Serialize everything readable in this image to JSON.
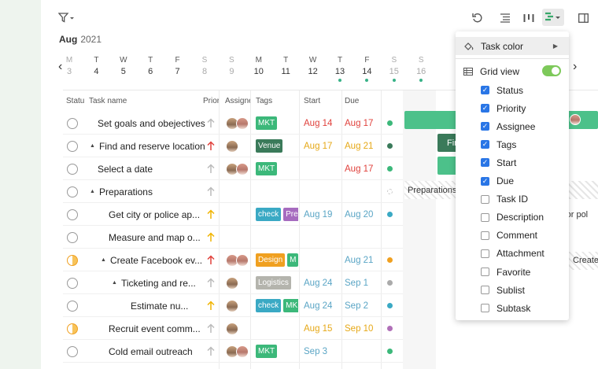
{
  "header": {
    "month": "Aug",
    "year": "2021"
  },
  "days": [
    {
      "w": "M",
      "d": "3",
      "weekend": true,
      "dot": false
    },
    {
      "w": "T",
      "d": "4",
      "weekend": false,
      "dot": false
    },
    {
      "w": "W",
      "d": "5",
      "weekend": false,
      "dot": false
    },
    {
      "w": "T",
      "d": "6",
      "weekend": false,
      "dot": false
    },
    {
      "w": "F",
      "d": "7",
      "weekend": false,
      "dot": false
    },
    {
      "w": "S",
      "d": "8",
      "weekend": true,
      "dot": false
    },
    {
      "w": "S",
      "d": "9",
      "weekend": true,
      "dot": false
    },
    {
      "w": "M",
      "d": "10",
      "weekend": false,
      "dot": false
    },
    {
      "w": "T",
      "d": "11",
      "weekend": false,
      "dot": false
    },
    {
      "w": "W",
      "d": "12",
      "weekend": false,
      "dot": false
    },
    {
      "w": "T",
      "d": "13",
      "weekend": false,
      "dot": true
    },
    {
      "w": "F",
      "d": "14",
      "weekend": false,
      "dot": true
    },
    {
      "w": "S",
      "d": "15",
      "weekend": true,
      "dot": true
    },
    {
      "w": "S",
      "d": "16",
      "weekend": true,
      "dot": true
    }
  ],
  "columns": {
    "status": "Statu",
    "name": "Task name",
    "priority": "Prior",
    "assignee": "Assigne",
    "tags": "Tags",
    "start": "Start",
    "due": "Due"
  },
  "rows": [
    {
      "status": "open",
      "indent": 0,
      "tri": false,
      "name": "Set goals and obejectives",
      "prio": "low",
      "avatars": [
        "m",
        "f"
      ],
      "tags": [
        {
          "t": "MKT",
          "c": "#3cb87a"
        }
      ],
      "start": "Aug 14",
      "startColor": "#e0413c",
      "due": "Aug 17",
      "dueColor": "#e0413c",
      "dot": "#3cb87a"
    },
    {
      "status": "open",
      "indent": 0,
      "tri": true,
      "name": "Find and reserve location",
      "prio": "high",
      "avatars": [
        "m"
      ],
      "tags": [
        {
          "t": "Venue",
          "c": "#3a7a5a"
        }
      ],
      "start": "Aug 17",
      "startColor": "#e6a817",
      "due": "Aug 21",
      "dueColor": "#e6a817",
      "dot": "#3a7a5a"
    },
    {
      "status": "open",
      "indent": 0,
      "tri": false,
      "name": "Select a date",
      "prio": "low",
      "avatars": [
        "m",
        "f"
      ],
      "tags": [
        {
          "t": "MKT",
          "c": "#3cb87a"
        }
      ],
      "start": "",
      "startColor": "#333",
      "due": "Aug 17",
      "dueColor": "#e0413c",
      "dot": "#3cb87a"
    },
    {
      "status": "open",
      "indent": 0,
      "tri": true,
      "name": "Preparations",
      "prio": "low",
      "avatars": [],
      "tags": [],
      "start": "",
      "startColor": "#333",
      "due": "",
      "dueColor": "#333",
      "dot": "hatch"
    },
    {
      "status": "open",
      "indent": 1,
      "tri": false,
      "name": "Get city or police ap...",
      "prio": "med",
      "avatars": [],
      "tags": [
        {
          "t": "check",
          "c": "#3aa9c4"
        },
        {
          "t": "Pre",
          "c": "#a66bbf"
        }
      ],
      "start": "Aug 19",
      "startColor": "#5aa5c5",
      "due": "Aug 20",
      "dueColor": "#5aa5c5",
      "dot": "#3aa9c4"
    },
    {
      "status": "open",
      "indent": 1,
      "tri": false,
      "name": "Measure and map o...",
      "prio": "med",
      "avatars": [],
      "tags": [],
      "start": "",
      "startColor": "#333",
      "due": "",
      "dueColor": "#333",
      "dot": ""
    },
    {
      "status": "half",
      "indent": 1,
      "tri": true,
      "name": "Create Facebook ev...",
      "prio": "high",
      "avatars": [
        "f",
        "f"
      ],
      "tags": [
        {
          "t": "Design",
          "c": "#f0a020"
        },
        {
          "t": "M",
          "c": "#3cb87a"
        }
      ],
      "start": "",
      "startColor": "#333",
      "due": "Aug 21",
      "dueColor": "#5aa5c5",
      "dot": "#f0a020"
    },
    {
      "status": "open",
      "indent": 2,
      "tri": true,
      "name": "Ticketing and re...",
      "prio": "low",
      "avatars": [
        "m"
      ],
      "tags": [
        {
          "t": "Logistics",
          "c": "#b4b4ad"
        }
      ],
      "start": "Aug 24",
      "startColor": "#5aa5c5",
      "due": "Sep 1",
      "dueColor": "#5aa5c5",
      "dot": "#aaaaaa"
    },
    {
      "status": "open",
      "indent": 3,
      "tri": false,
      "name": "Estimate nu...",
      "prio": "med",
      "avatars": [
        "m"
      ],
      "tags": [
        {
          "t": "check",
          "c": "#3aa9c4"
        },
        {
          "t": "MK",
          "c": "#3cb87a"
        }
      ],
      "start": "Aug 24",
      "startColor": "#5aa5c5",
      "due": "Sep 2",
      "dueColor": "#5aa5c5",
      "dot": "#3aa9c4"
    },
    {
      "status": "half",
      "indent": 1,
      "tri": false,
      "name": "Recruit event comm...",
      "prio": "low",
      "avatars": [
        "m"
      ],
      "tags": [],
      "start": "Aug 15",
      "startColor": "#e6a817",
      "due": "Sep 10",
      "dueColor": "#e6a817",
      "dot": "#b070b8"
    },
    {
      "status": "open",
      "indent": 1,
      "tri": false,
      "name": "Cold email outreach",
      "prio": "low",
      "avatars": [
        "m",
        "f"
      ],
      "tags": [
        {
          "t": "MKT",
          "c": "#3cb87a"
        }
      ],
      "start": "Sep 3",
      "startColor": "#5aa5c5",
      "due": "",
      "dueColor": "#333",
      "dot": "#3cb87a"
    }
  ],
  "gantt": {
    "bar2_label": "Fir",
    "prep_label": "Preparations",
    "row5_label": "ty or pol",
    "row7_label": "Create"
  },
  "menu": {
    "task_color": "Task color",
    "grid_view": "Grid view",
    "items": [
      {
        "label": "Status",
        "on": true
      },
      {
        "label": "Priority",
        "on": true
      },
      {
        "label": "Assignee",
        "on": true
      },
      {
        "label": "Tags",
        "on": true
      },
      {
        "label": "Start",
        "on": true
      },
      {
        "label": "Due",
        "on": true
      },
      {
        "label": "Task ID",
        "on": false
      },
      {
        "label": "Description",
        "on": false
      },
      {
        "label": "Comment",
        "on": false
      },
      {
        "label": "Attachment",
        "on": false
      },
      {
        "label": "Favorite",
        "on": false
      },
      {
        "label": "Sublist",
        "on": false
      },
      {
        "label": "Subtask",
        "on": false
      }
    ]
  },
  "colors": {
    "accent": "#2a76e6",
    "toggle": "#7dc95a",
    "gantt_green": "#4cc18a"
  }
}
